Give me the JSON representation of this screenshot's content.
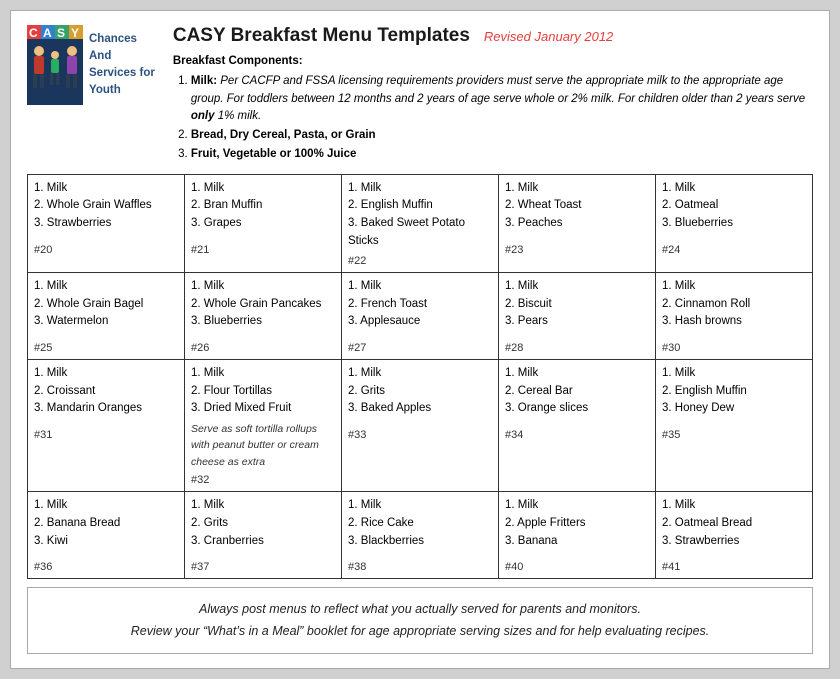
{
  "header": {
    "logo_casy": "CASY",
    "logo_c": "C",
    "logo_a": "A",
    "logo_s": "S",
    "logo_y": "Y",
    "logo_name_line1": "Chances",
    "logo_name_line2": "And",
    "logo_name_line3": "Services for",
    "logo_name_line4": "Youth",
    "title": "CASY Breakfast Menu Templates",
    "revised": "Revised January 2012",
    "components_label": "Breakfast Components:",
    "comp1_label": "Milk:",
    "comp1_text": " Per CACFP and FSSA licensing requirements providers must serve the appropriate milk to the appropriate age group. For toddlers between 12 months and 2 years of age serve whole or 2% milk. For children older than 2 years serve ",
    "comp1_only": "only",
    "comp1_text2": " 1% milk.",
    "comp2": "Bread, Dry Cereal, Pasta, or Grain",
    "comp3": "Fruit, Vegetable or 100% Juice"
  },
  "rows": [
    {
      "cells": [
        {
          "items": [
            "1. Milk",
            "2. Whole Grain Waffles",
            "3. Strawberries"
          ],
          "num": "#20"
        },
        {
          "items": [
            "1. Milk",
            "2. Bran Muffin",
            "3. Grapes"
          ],
          "num": "#21"
        },
        {
          "items": [
            "1. Milk",
            "2. English Muffin",
            "3. Baked Sweet Potato Sticks"
          ],
          "num": "#22"
        },
        {
          "items": [
            "1. Milk",
            "2. Wheat Toast",
            "3.  Peaches"
          ],
          "num": "#23"
        },
        {
          "items": [
            "1. Milk",
            "2. Oatmeal",
            "3. Blueberries"
          ],
          "num": "#24"
        }
      ]
    },
    {
      "cells": [
        {
          "items": [
            "1. Milk",
            "2. Whole Grain Bagel",
            "3. Watermelon"
          ],
          "num": "#25"
        },
        {
          "items": [
            "1. Milk",
            "2. Whole Grain Pancakes",
            "3. Blueberries"
          ],
          "num": "#26"
        },
        {
          "items": [
            "1. Milk",
            "2. French Toast",
            "3. Applesauce"
          ],
          "num": "#27"
        },
        {
          "items": [
            "1.  Milk",
            "2.  Biscuit",
            "3.  Pears"
          ],
          "num": "#28"
        },
        {
          "items": [
            "1. Milk",
            "2.  Cinnamon Roll",
            "3.  Hash browns"
          ],
          "num": "#30"
        }
      ]
    },
    {
      "cells": [
        {
          "items": [
            "1.  Milk",
            "2.   Croissant",
            "3.   Mandarin Oranges"
          ],
          "num": "#31",
          "note": ""
        },
        {
          "items": [
            "1.   Milk",
            "2.   Flour Tortillas",
            "3.   Dried Mixed Fruit"
          ],
          "num": "#32",
          "note": "Serve as soft tortilla  rollups with peanut butter or cream cheese as extra"
        },
        {
          "items": [
            "1.  Milk",
            "2.  Grits",
            "3.  Baked Apples"
          ],
          "num": "#33"
        },
        {
          "items": [
            "1.  Milk",
            "2.  Cereal Bar",
            "3.  Orange slices"
          ],
          "num": "#34"
        },
        {
          "items": [
            "1.  Milk",
            "2.  English Muffin",
            "3.  Honey Dew"
          ],
          "num": "#35"
        }
      ]
    },
    {
      "cells": [
        {
          "items": [
            "1. Milk",
            "2. Banana Bread",
            "3. Kiwi"
          ],
          "num": "#36"
        },
        {
          "items": [
            "1. Milk",
            "2. Grits",
            "3. Cranberries"
          ],
          "num": "#37"
        },
        {
          "items": [
            "1. Milk",
            "2. Rice Cake",
            "3. Blackberries"
          ],
          "num": "#38"
        },
        {
          "items": [
            "1. Milk",
            "2. Apple Fritters",
            "3. Banana"
          ],
          "num": "#40"
        },
        {
          "items": [
            "1. Milk",
            "2. Oatmeal Bread",
            "3. Strawberries"
          ],
          "num": "#41"
        }
      ]
    }
  ],
  "footer": {
    "line1": "Always post menus to reflect what you actually served for parents and monitors.",
    "line2": "Review your “What’s in a Meal” booklet for age appropriate serving sizes and for help evaluating recipes."
  }
}
